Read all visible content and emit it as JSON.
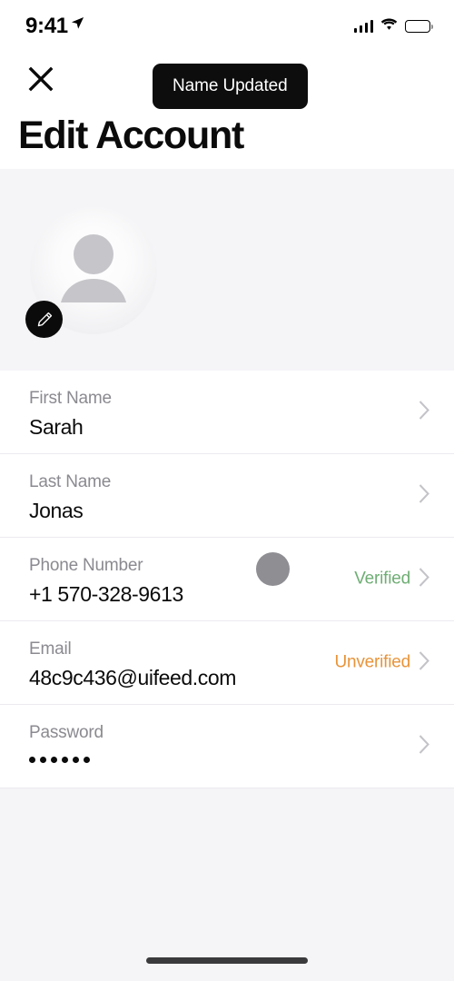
{
  "status_bar": {
    "time": "9:41",
    "location_icon": "location-arrow-icon",
    "signal_icon": "cellular-signal-icon",
    "wifi_icon": "wifi-icon",
    "battery_icon": "battery-full-icon"
  },
  "nav": {
    "close_label": "close-icon",
    "toast_message": "Name Updated"
  },
  "header": {
    "title": "Edit Account"
  },
  "avatar": {
    "placeholder_icon": "person-silhouette-icon",
    "edit_icon": "pencil-icon",
    "background_color": "#f5f4f7"
  },
  "fields": [
    {
      "label": "First Name",
      "value": "Sarah",
      "status": "",
      "status_color": "",
      "type": "text",
      "name": "first-name"
    },
    {
      "label": "Last Name",
      "value": "Jonas",
      "status": "",
      "status_color": "",
      "type": "text",
      "name": "last-name"
    },
    {
      "label": "Phone Number",
      "value": "+1 570-328-9613",
      "status": "Verified",
      "status_color": "#6fae74",
      "type": "text",
      "name": "phone-number"
    },
    {
      "label": "Email",
      "value": "48c9c436@uifeed.com",
      "status": "Unverified",
      "status_color": "#e8943a",
      "type": "text",
      "name": "email"
    },
    {
      "label": "Password",
      "value": "••••••",
      "status": "",
      "status_color": "",
      "type": "password",
      "name": "password"
    }
  ],
  "colors": {
    "accent_verified": "#6fae74",
    "accent_unverified": "#e8943a",
    "toast_background": "#0d0d0d",
    "section_background": "#f5f4f7",
    "chevron": "#c3c3c8",
    "label_text": "#8a8a90",
    "value_text": "#0b0b0b"
  },
  "home_indicator": {
    "label": "home-indicator"
  }
}
